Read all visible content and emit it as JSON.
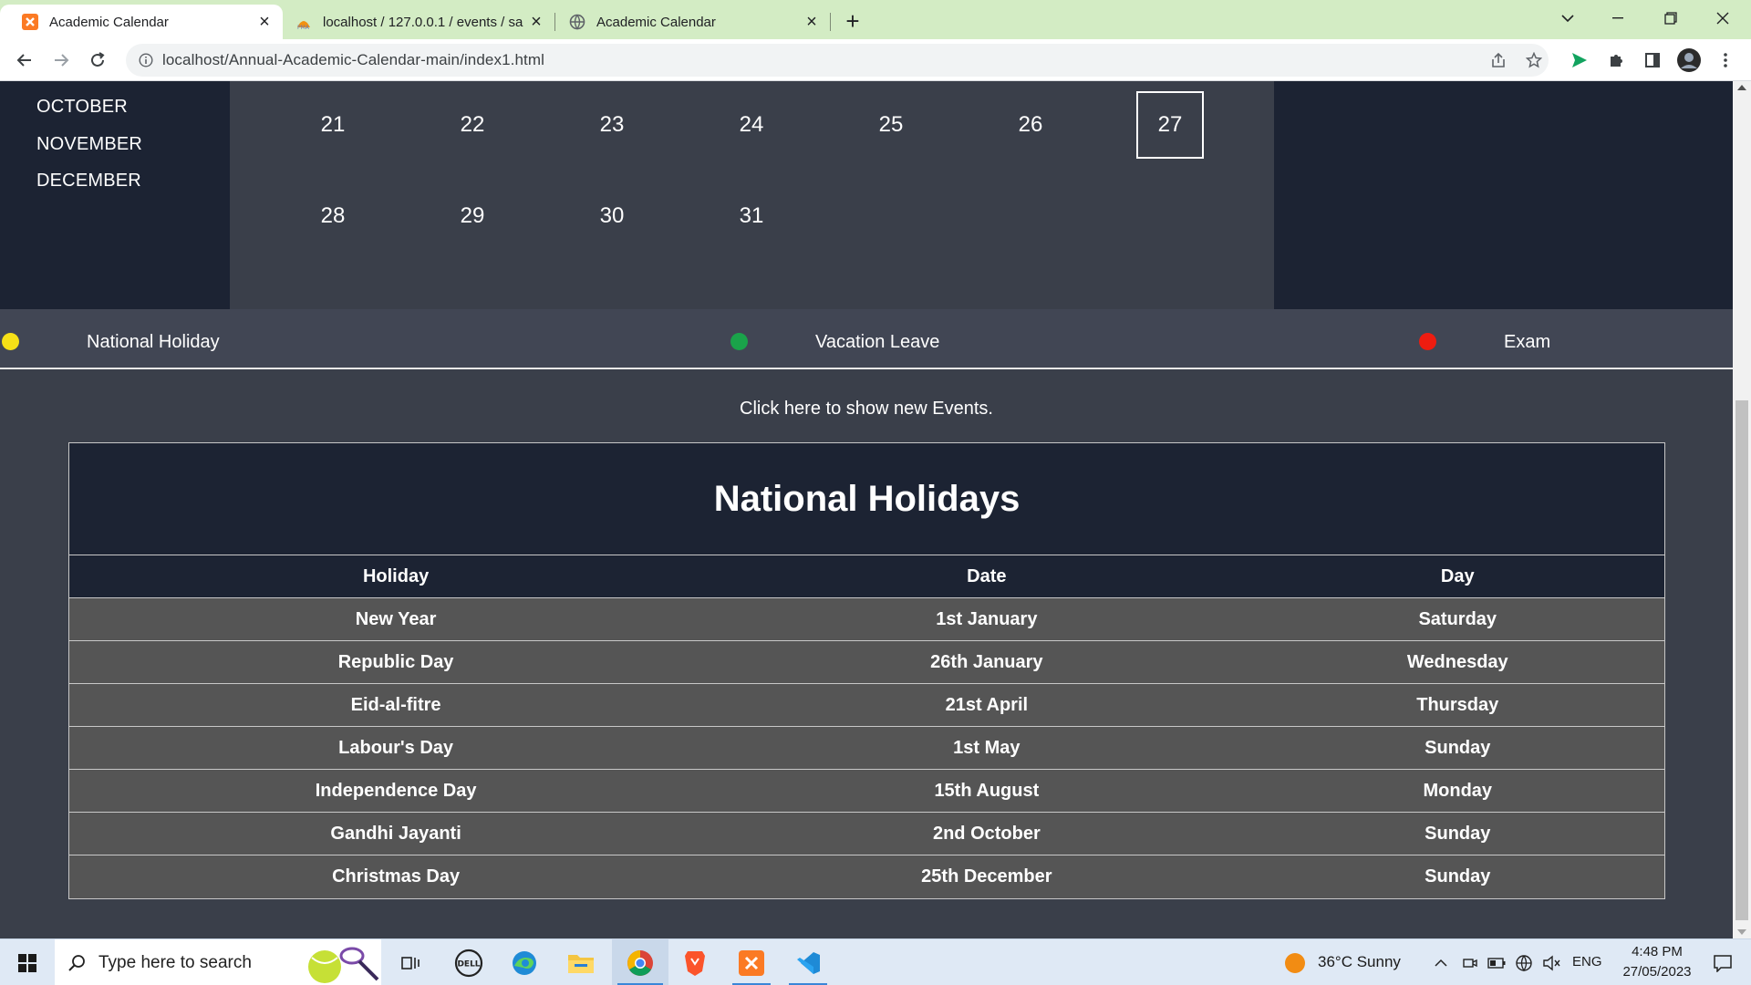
{
  "browser": {
    "tabs": [
      {
        "title": "Academic Calendar",
        "active": true
      },
      {
        "title": "localhost / 127.0.0.1 / events / sa",
        "active": false
      },
      {
        "title": "Academic Calendar",
        "active": false
      }
    ],
    "url": "localhost/Annual-Academic-Calendar-main/index1.html"
  },
  "calendar": {
    "months": [
      "OCTOBER",
      "NOVEMBER",
      "DECEMBER"
    ],
    "weeks": [
      [
        "21",
        "22",
        "23",
        "24",
        "25",
        "26",
        "27"
      ],
      [
        "28",
        "29",
        "30",
        "31"
      ]
    ],
    "today": "27"
  },
  "legend": [
    {
      "label": "National Holiday",
      "color": "#f6e017"
    },
    {
      "label": "Vacation Leave",
      "color": "#1aa34a"
    },
    {
      "label": "Exam",
      "color": "#ee1c10"
    }
  ],
  "show_events_link": "Click here to show new Events.",
  "holidays": {
    "title": "National Holidays",
    "columns": [
      "Holiday",
      "Date",
      "Day"
    ],
    "rows": [
      [
        "New Year",
        "1st January",
        "Saturday"
      ],
      [
        "Republic Day",
        "26th January",
        "Wednesday"
      ],
      [
        "Eid-al-fitre",
        "21st April",
        "Thursday"
      ],
      [
        "Labour's Day",
        "1st May",
        "Sunday"
      ],
      [
        "Independence Day",
        "15th August",
        "Monday"
      ],
      [
        "Gandhi Jayanti",
        "2nd October",
        "Sunday"
      ],
      [
        "Christmas Day",
        "25th December",
        "Sunday"
      ]
    ]
  },
  "taskbar": {
    "search_placeholder": "Type here to search",
    "weather": "36°C  Sunny",
    "language": "ENG",
    "time": "4:48 PM",
    "date": "27/05/2023"
  },
  "colors": {
    "tab_strip": "#d3ecc4",
    "page_dark": "#1c2333",
    "page_mid": "#3a3f4a",
    "table_row": "#555555"
  }
}
